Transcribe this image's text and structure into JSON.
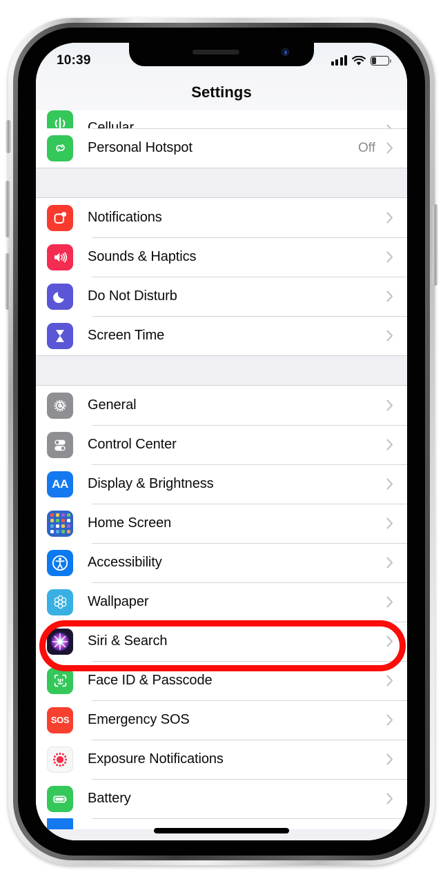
{
  "device": {
    "frame": "iphone-11",
    "notch_present": true
  },
  "status_bar": {
    "time": "10:39",
    "cellular_icon": "cellular-bars-icon",
    "wifi_icon": "wifi-icon",
    "battery_icon": "battery-icon",
    "battery_level_pct": 25
  },
  "nav": {
    "title": "Settings"
  },
  "colors": {
    "annotation_red": "#fb0d09",
    "list_background": "#efeff4",
    "row_background": "#ffffff",
    "separator": "#d4d4d8",
    "label_text": "#0a0a0a",
    "value_text": "#8b8b90",
    "chevron": "#c2c2c7"
  },
  "annotation": {
    "shape": "oval",
    "color": "#fb0d09",
    "targets_row": "Accessibility"
  },
  "groups": [
    {
      "id": "connectivity",
      "rows": [
        {
          "id": "cellular",
          "label": "Cellular",
          "value": "",
          "icon": "cellular-antenna-icon",
          "icon_color": "#34c759",
          "clipped": true
        },
        {
          "id": "personal-hotspot",
          "label": "Personal Hotspot",
          "value": "Off",
          "icon": "hotspot-link-icon",
          "icon_color": "#34c759",
          "clipped": false
        }
      ]
    },
    {
      "id": "alerts",
      "rows": [
        {
          "id": "notifications",
          "label": "Notifications",
          "value": "",
          "icon": "notifications-badge-icon",
          "icon_color": "#f93a2f",
          "clipped": false
        },
        {
          "id": "sounds-haptics",
          "label": "Sounds & Haptics",
          "value": "",
          "icon": "speaker-waves-icon",
          "icon_color": "#f42c52",
          "clipped": false
        },
        {
          "id": "do-not-disturb",
          "label": "Do Not Disturb",
          "value": "",
          "icon": "crescent-moon-icon",
          "icon_color": "#5a56d6",
          "clipped": false
        },
        {
          "id": "screen-time",
          "label": "Screen Time",
          "value": "",
          "icon": "hourglass-icon",
          "icon_color": "#5a56d6",
          "clipped": false
        }
      ]
    },
    {
      "id": "system",
      "rows": [
        {
          "id": "general",
          "label": "General",
          "value": "",
          "icon": "gear-icon",
          "icon_color": "#8e8e93",
          "clipped": false
        },
        {
          "id": "control-center",
          "label": "Control Center",
          "value": "",
          "icon": "toggles-icon",
          "icon_color": "#8e8e93",
          "clipped": false
        },
        {
          "id": "display-brightness",
          "label": "Display & Brightness",
          "value": "",
          "icon": "aa-text-size-icon",
          "icon_color": "#1479ef",
          "clipped": false
        },
        {
          "id": "home-screen",
          "label": "Home Screen",
          "value": "",
          "icon": "home-screen-grid-icon",
          "icon_color": "#2f63c8",
          "clipped": false
        },
        {
          "id": "accessibility",
          "label": "Accessibility",
          "value": "",
          "icon": "accessibility-person-icon",
          "icon_color": "#0b79ef",
          "clipped": false,
          "highlighted": true
        },
        {
          "id": "wallpaper",
          "label": "Wallpaper",
          "value": "",
          "icon": "wallpaper-flower-icon",
          "icon_color": "#38b0e3",
          "clipped": false
        },
        {
          "id": "siri-search",
          "label": "Siri & Search",
          "value": "",
          "icon": "siri-orb-icon",
          "icon_color": "#1b1430",
          "clipped": false
        },
        {
          "id": "face-id-passcode",
          "label": "Face ID & Passcode",
          "value": "",
          "icon": "face-id-icon",
          "icon_color": "#34c759",
          "clipped": false
        },
        {
          "id": "emergency-sos",
          "label": "Emergency SOS",
          "value": "",
          "icon": "sos-icon",
          "icon_color": "#f8402f",
          "clipped": false
        },
        {
          "id": "exposure-notifications",
          "label": "Exposure Notifications",
          "value": "",
          "icon": "exposure-notifications-icon",
          "icon_color": "#f7f7f7",
          "clipped": false
        },
        {
          "id": "battery",
          "label": "Battery",
          "value": "",
          "icon": "battery-green-icon",
          "icon_color": "#34c759",
          "clipped": false
        }
      ]
    }
  ]
}
